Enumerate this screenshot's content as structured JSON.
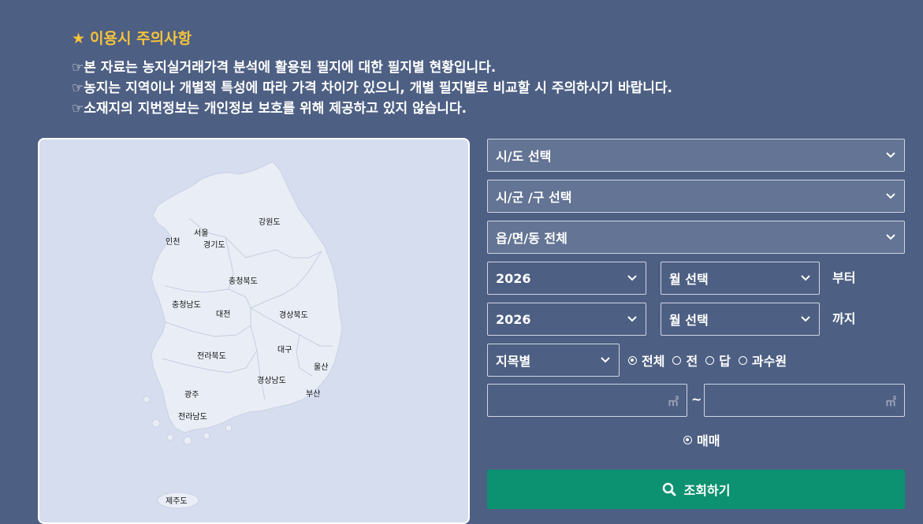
{
  "notice": {
    "title": "이용시 주의사항",
    "star": "★",
    "lines": [
      "☞본 자료는 농지실거래가격 분석에 활용된 필지에 대한 필지별 현황입니다.",
      "☞농지는 지역이나 개별적 특성에 따라 가격 차이가 있으니, 개별 필지별로 비교할 시 주의하시기 바랍니다.",
      "☞소재지의 지번정보는 개인정보 보호를 위해 제공하고 있지 않습니다."
    ]
  },
  "map": {
    "regions": [
      "강원도",
      "서울",
      "인천",
      "경기도",
      "충청북도",
      "충청남도",
      "대전",
      "경상북도",
      "대구",
      "울산",
      "전라북도",
      "경상남도",
      "부산",
      "광주",
      "전라남도",
      "제주도"
    ]
  },
  "filters": {
    "sido": "시/도 선택",
    "sigungu": "시/군 /구 선택",
    "eupmyeondong": "읍/면/동 전체",
    "start_year": "2026",
    "start_month": "월 선택",
    "start_suffix": "부터",
    "end_year": "2026",
    "end_month": "월 선택",
    "end_suffix": "까지",
    "land_category": "지목별",
    "land_types": [
      "전체",
      "전",
      "답",
      "과수원"
    ],
    "selected_land_type": "전체",
    "area_unit": "㎡",
    "area_separator": "~",
    "trade_type": "매매"
  },
  "search_button": "조회하기",
  "colors": {
    "background": "#4d5f83",
    "accent_title": "#f5c33b",
    "button": "#0c9270",
    "map_bg": "#d6ddef"
  }
}
